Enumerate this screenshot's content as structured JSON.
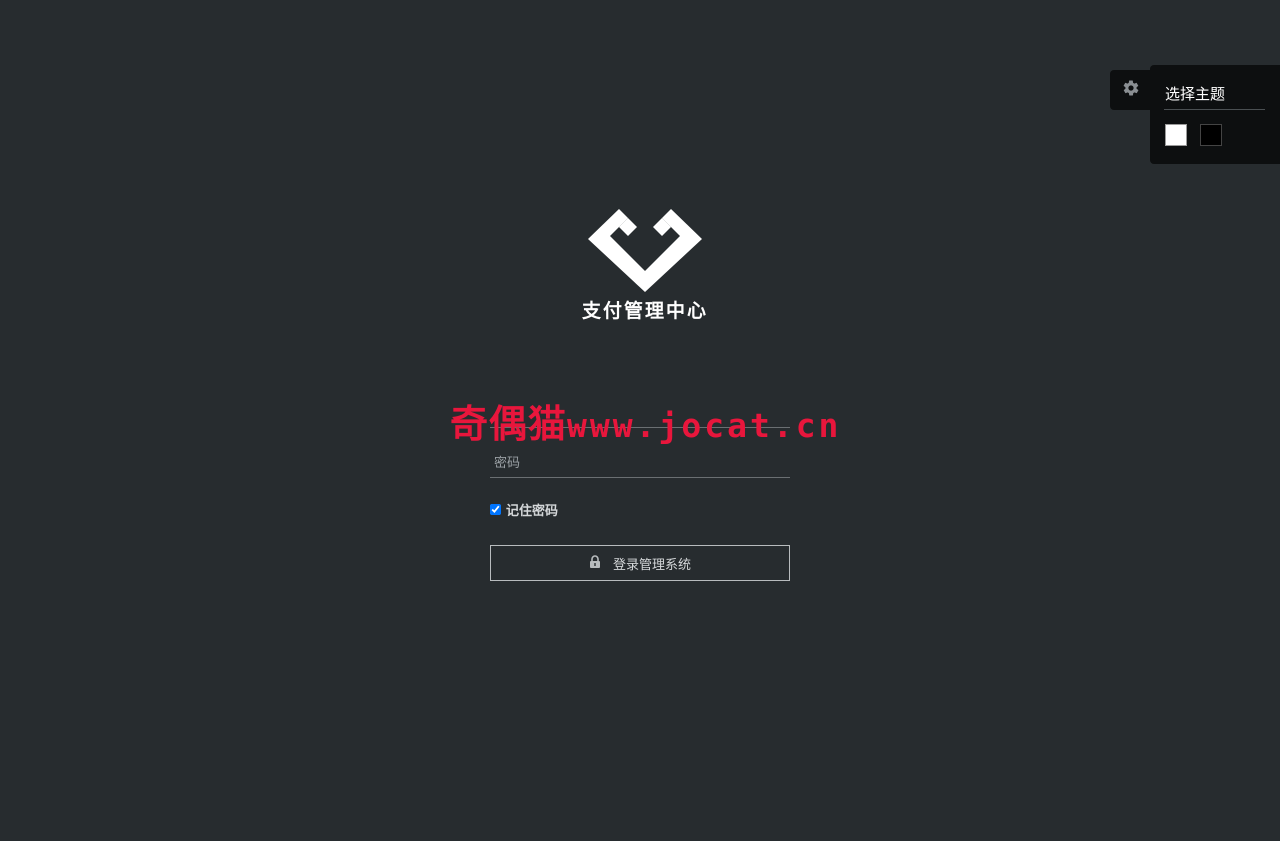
{
  "theme": {
    "title": "选择主题",
    "toggle_icon": "gear-icon",
    "swatches": [
      {
        "name": "white",
        "color": "#ffffff"
      },
      {
        "name": "black",
        "color": "#000000"
      }
    ]
  },
  "brand": {
    "logo_icon": "diamond-heart-logo",
    "name": "支付管理中心"
  },
  "login": {
    "username_placeholder": "",
    "password_placeholder": "密码",
    "remember_label": "记住密码",
    "remember_checked": true,
    "submit_label": "登录管理系统",
    "submit_icon": "lock-icon"
  },
  "watermark": {
    "cn": "奇偶猫",
    "url": "www.jocat.cn"
  },
  "colors": {
    "background": "#272c2f",
    "panel": "#0d0f10",
    "watermark": "#e8163c"
  }
}
